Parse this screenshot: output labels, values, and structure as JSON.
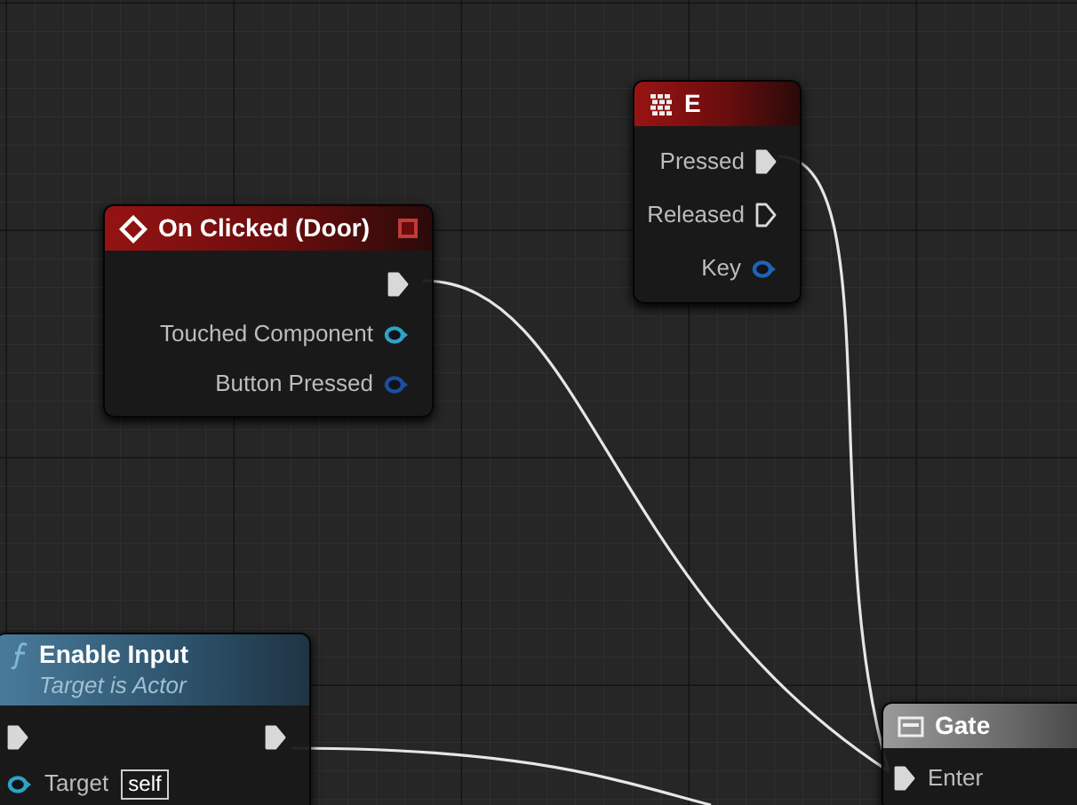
{
  "nodes": [
    {
      "kind": "input_key",
      "title": "E",
      "rows": [
        {
          "out": {
            "kind": "exec",
            "label": "Pressed",
            "connected": true
          }
        },
        {
          "out": {
            "kind": "exec",
            "label": "Released",
            "connected": false
          }
        },
        {
          "out": {
            "kind": "data",
            "label": "Key",
            "color": "#1e63b8"
          }
        }
      ]
    },
    {
      "kind": "event",
      "title": "On Clicked (Door)",
      "rows": [
        {
          "out": {
            "kind": "exec",
            "connected": true
          }
        },
        {
          "out": {
            "kind": "data",
            "label": "Touched Component",
            "color": "#2ea3c8"
          }
        },
        {
          "out": {
            "kind": "data",
            "label": "Button Pressed",
            "color": "#1a4f9e"
          }
        }
      ]
    },
    {
      "kind": "function",
      "title": "Enable Input",
      "subtitle": "Target is Actor",
      "rows": [
        {
          "in": {
            "kind": "exec",
            "connected": true
          },
          "out": {
            "kind": "exec",
            "connected": true
          }
        },
        {
          "in": {
            "kind": "data",
            "label": "Target",
            "value": "self",
            "color": "#2ea3c8"
          }
        }
      ]
    },
    {
      "kind": "macro",
      "title": "Gate",
      "rows": [
        {
          "in": {
            "kind": "exec",
            "label": "Enter",
            "connected": true
          }
        }
      ]
    }
  ]
}
